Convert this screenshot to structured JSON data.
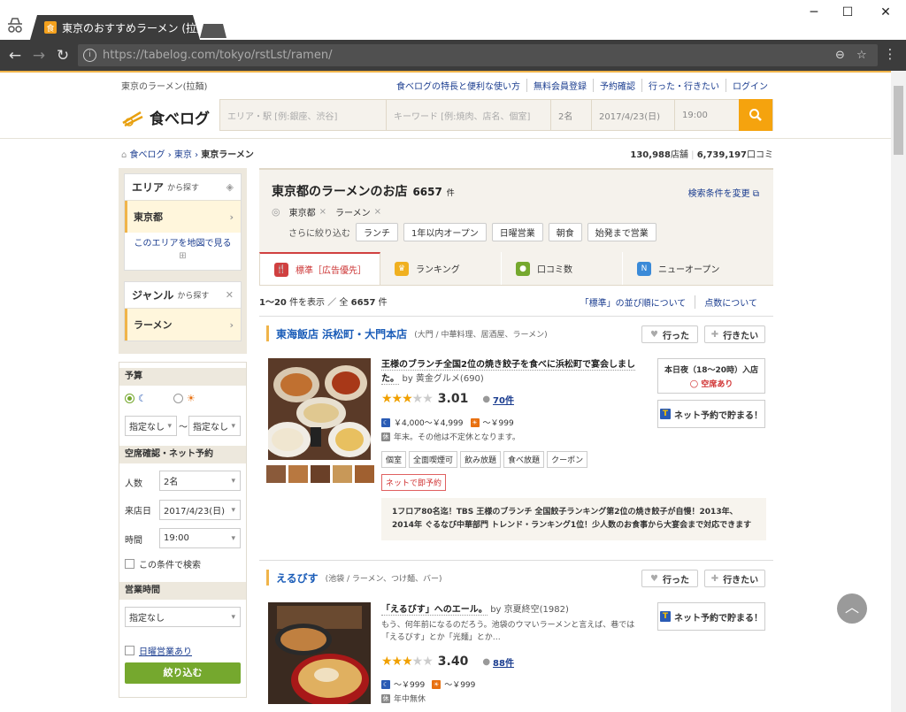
{
  "browser": {
    "tab_title": "東京のおすすめラーメン (拉麺",
    "url_host": "https://tabelog.com",
    "url_path": "/tokyo/rstLst/ramen/"
  },
  "header": {
    "page_label": "東京のラーメン(拉麺)",
    "links": [
      "食べログの特長と便利な使い方",
      "無料会員登録",
      "予約確認",
      "行った・行きたい",
      "ログイン"
    ],
    "logo_text": "食べログ",
    "area_placeholder": "エリア・駅 [例:銀座、渋谷]",
    "keyword_placeholder": "キーワード [例:焼肉、店名、個室]",
    "people": "2名",
    "date": "2017/4/23(日)",
    "time": "19:00"
  },
  "breadcrumb": {
    "home": "食べログ",
    "pref": "東京",
    "current": "東京ラーメン"
  },
  "counts": {
    "stores": "130,988",
    "stores_unit": "店舗",
    "reviews": "6,739,197",
    "reviews_unit": "口コミ"
  },
  "sidebar": {
    "area_title": "エリア",
    "area_suffix": "から探す",
    "area_value": "東京都",
    "map_link": "このエリアを地図で見る",
    "genre_title": "ジャンル",
    "genre_suffix": "から探す",
    "genre_value": "ラーメン",
    "budget_title": "予算",
    "budget_min": "指定なし",
    "budget_sep": "〜",
    "budget_max": "指定なし",
    "vacancy_title": "空席確認・ネット予約",
    "people_label": "人数",
    "people_value": "2名",
    "date_label": "来店日",
    "date_value": "2017/4/23(日)",
    "time_label": "時間",
    "time_value": "19:00",
    "search_cond": "この条件で検索",
    "hours_title": "営業時間",
    "hours_value": "指定なし",
    "sunday_open": "日曜営業あり",
    "narrow_button": "絞り込む"
  },
  "main": {
    "title": "東京都のラーメンのお店",
    "count": "6657",
    "count_unit": "件",
    "change_cond": "検索条件を変更",
    "tag1": "東京都",
    "tag2": "ラーメン",
    "narrow_label": "さらに絞り込む",
    "pills": [
      "ランチ",
      "1年以内オープン",
      "日曜営業",
      "朝食",
      "始発まで営業"
    ],
    "tabs": [
      "標準［広告優先］",
      "ランキング",
      "口コミ数",
      "ニューオープン"
    ],
    "result_range": "1～20",
    "result_mid": "件を表示 ／ 全",
    "result_total": "6657",
    "result_unit": "件",
    "sort_links": [
      "「標準」の並び順について",
      "点数について"
    ]
  },
  "list": [
    {
      "name": "東海飯店 浜松町・大門本店",
      "sub": "(大門 / 中華料理、居酒屋、ラーメン)",
      "went": "行った",
      "want": "行きたい",
      "catch": "王様のブランチ全国2位の焼き餃子を食べに浜松町で宴会しました。",
      "by": "by 黄金グルメ(690)",
      "score": "3.01",
      "reviews": "70件",
      "dinner": "￥4,000～￥4,999",
      "lunch": "～￥999",
      "holiday": "年末。その他は不定休となります。",
      "tags": [
        "個室",
        "全面喫煙可",
        "飲み放題",
        "食べ放題",
        "クーポン"
      ],
      "net": "ネットで即予約",
      "tonight": "本日夜（18～20時）入店",
      "vacant": "空席あり",
      "reserve": "ネット予約で貯まる！",
      "pr": "1フロア80名迄！TBS 王様のブランチ 全国餃子ランキング第2位の焼き餃子が自慢！2013年、2014年 ぐるなび中華部門 トレンド・ランキング1位！少人数のお食事から大宴会まで対応できます"
    },
    {
      "name": "えるびす",
      "sub": "(池袋 / ラーメン、つけ麺、バー)",
      "went": "行った",
      "want": "行きたい",
      "catch": "「えるびす」へのエール。",
      "by": "by 京夏終空(1982)",
      "review": "もう、何年前になるのだろう。池袋のウマいラーメンと言えば、巷では「えるびす」とか「光麺」とか…",
      "score": "3.40",
      "reviews": "88件",
      "dinner": "～￥999",
      "lunch": "～￥999",
      "holiday": "年中無休",
      "reserve": "ネット予約で貯まる！"
    }
  ]
}
